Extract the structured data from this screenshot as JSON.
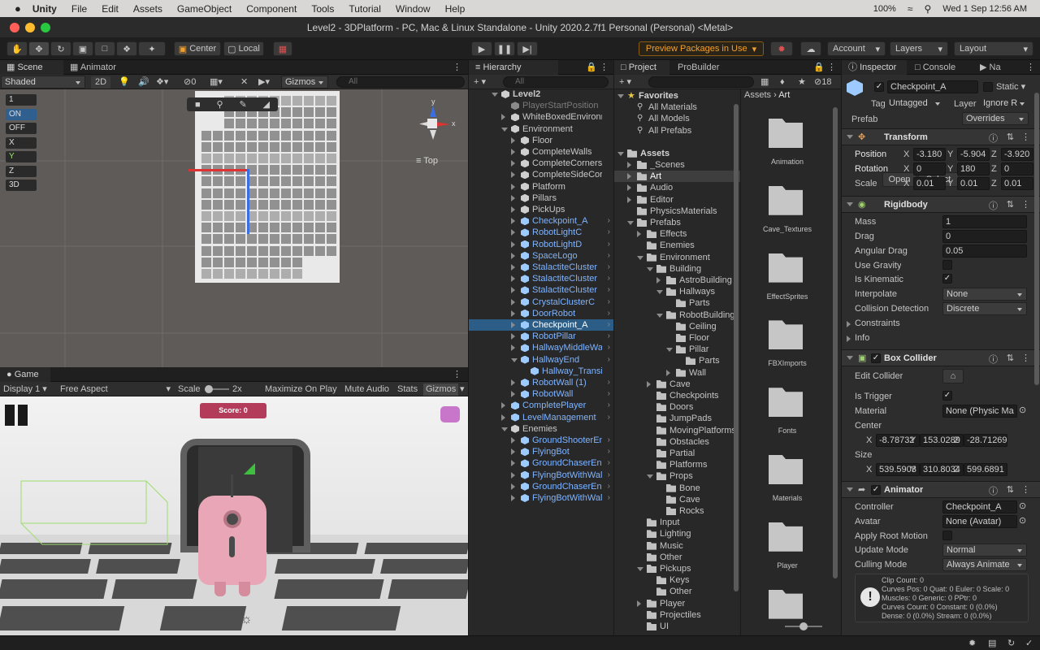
{
  "menubar": {
    "app": "Unity",
    "items": [
      "File",
      "Edit",
      "Assets",
      "GameObject",
      "Component",
      "Tools",
      "Tutorial",
      "Window",
      "Help"
    ],
    "battery": "100%",
    "datetime": "Wed 1 Sep  12:56 AM"
  },
  "window": {
    "title": "Level2 - 3DPlatform - PC, Mac & Linux Standalone - Unity 2020.2.7f1 Personal (Personal) <Metal>"
  },
  "toolbar": {
    "center": "Center",
    "local": "Local",
    "preview_packages": "Preview Packages in Use",
    "account": "Account",
    "layers": "Layers",
    "layout": "Layout"
  },
  "scene": {
    "tab_scene": "Scene",
    "tab_animator": "Animator",
    "shading": "Shaded",
    "mode2d": "2D",
    "hidden_count": "0",
    "gizmos": "Gizmos",
    "search_placeholder": "All",
    "view_label": "Top",
    "axis_x": "x",
    "axis_y": "y",
    "left_tools": [
      "1",
      "ON",
      "OFF",
      "X",
      "Y",
      "Z",
      "3D"
    ]
  },
  "game": {
    "tab": "Game",
    "display": "Display 1",
    "aspect": "Free Aspect",
    "scale_label": "Scale",
    "scale_value": "2x",
    "maximize": "Maximize On Play",
    "mute": "Mute Audio",
    "stats": "Stats",
    "gizmos": "Gizmos",
    "score": "Score: 0"
  },
  "hierarchy": {
    "tab": "Hierarchy",
    "search_placeholder": "All",
    "rows": [
      {
        "label": "Level2",
        "indent": 0,
        "arrow": "down",
        "icon": "unity",
        "bold": true
      },
      {
        "label": "PlayerStartPosition",
        "indent": 1,
        "arrow": "",
        "icon": "grey",
        "dim": true
      },
      {
        "label": "WhiteBoxedEnvironment",
        "indent": 1,
        "arrow": "right",
        "icon": "white"
      },
      {
        "label": "Environment",
        "indent": 1,
        "arrow": "down",
        "icon": "white"
      },
      {
        "label": "Floor",
        "indent": 2,
        "arrow": "right",
        "icon": "white"
      },
      {
        "label": "CompleteWalls",
        "indent": 2,
        "arrow": "right",
        "icon": "white"
      },
      {
        "label": "CompleteCorners",
        "indent": 2,
        "arrow": "right",
        "icon": "white"
      },
      {
        "label": "CompleteSideCorners",
        "indent": 2,
        "arrow": "right",
        "icon": "white"
      },
      {
        "label": "Platform",
        "indent": 2,
        "arrow": "right",
        "icon": "white"
      },
      {
        "label": "Pillars",
        "indent": 2,
        "arrow": "right",
        "icon": "white"
      },
      {
        "label": "PickUps",
        "indent": 2,
        "arrow": "right",
        "icon": "white"
      },
      {
        "label": "Checkpoint_A",
        "indent": 2,
        "arrow": "right",
        "icon": "blue",
        "blue": true,
        "more": true
      },
      {
        "label": "RobotLightC",
        "indent": 2,
        "arrow": "right",
        "icon": "blue",
        "blue": true,
        "more": true
      },
      {
        "label": "RobotLightD",
        "indent": 2,
        "arrow": "right",
        "icon": "blue",
        "blue": true,
        "more": true
      },
      {
        "label": "SpaceLogo",
        "indent": 2,
        "arrow": "right",
        "icon": "blue",
        "blue": true,
        "more": true
      },
      {
        "label": "StalactiteCluster",
        "indent": 2,
        "arrow": "right",
        "icon": "blue",
        "blue": true,
        "more": true
      },
      {
        "label": "StalactiteCluster",
        "indent": 2,
        "arrow": "right",
        "icon": "blue",
        "blue": true,
        "more": true
      },
      {
        "label": "StalactiteCluster",
        "indent": 2,
        "arrow": "right",
        "icon": "blue",
        "blue": true,
        "more": true
      },
      {
        "label": "CrystalClusterC",
        "indent": 2,
        "arrow": "right",
        "icon": "blue",
        "blue": true,
        "more": true
      },
      {
        "label": "DoorRobot",
        "indent": 2,
        "arrow": "right",
        "icon": "blue",
        "blue": true,
        "more": true
      },
      {
        "label": "Checkpoint_A",
        "indent": 2,
        "arrow": "right",
        "icon": "blue",
        "sel": true,
        "more": true
      },
      {
        "label": "RobotPillar",
        "indent": 2,
        "arrow": "right",
        "icon": "blue",
        "blue": true,
        "more": true
      },
      {
        "label": "HallwayMiddleWall",
        "indent": 2,
        "arrow": "right",
        "icon": "blue",
        "blue": true,
        "more": true
      },
      {
        "label": "HallwayEnd",
        "indent": 2,
        "arrow": "down",
        "icon": "blue",
        "blue": true,
        "more": true
      },
      {
        "label": "Hallway_Transition",
        "indent": 3,
        "arrow": "",
        "icon": "blue",
        "blue": true
      },
      {
        "label": "RobotWall (1)",
        "indent": 2,
        "arrow": "right",
        "icon": "blue",
        "blue": true,
        "more": true
      },
      {
        "label": "RobotWall",
        "indent": 2,
        "arrow": "right",
        "icon": "blue",
        "blue": true,
        "more": true
      },
      {
        "label": "CompletePlayer",
        "indent": 1,
        "arrow": "right",
        "icon": "blue",
        "blue": true,
        "more": true
      },
      {
        "label": "LevelManagement",
        "indent": 1,
        "arrow": "right",
        "icon": "blue",
        "blue": true,
        "more": true
      },
      {
        "label": "Enemies",
        "indent": 1,
        "arrow": "down",
        "icon": "white"
      },
      {
        "label": "GroundShooterEnemy",
        "indent": 2,
        "arrow": "right",
        "icon": "blue",
        "blue": true,
        "more": true
      },
      {
        "label": "FlyingBot",
        "indent": 2,
        "arrow": "right",
        "icon": "blue",
        "blue": true,
        "more": true
      },
      {
        "label": "GroundChaserEnemy",
        "indent": 2,
        "arrow": "right",
        "icon": "blue",
        "blue": true,
        "more": true
      },
      {
        "label": "FlyingBotWithWall",
        "indent": 2,
        "arrow": "right",
        "icon": "blue",
        "blue": true,
        "more": true
      },
      {
        "label": "GroundChaserEnemy",
        "indent": 2,
        "arrow": "right",
        "icon": "blue",
        "blue": true,
        "more": true
      },
      {
        "label": "FlyingBotWithWall",
        "indent": 2,
        "arrow": "right",
        "icon": "blue",
        "blue": true,
        "more": true
      }
    ]
  },
  "project": {
    "tab_project": "Project",
    "tab_probuilder": "ProBuilder",
    "hidden_count": "18",
    "favorites_label": "Favorites",
    "favorites": [
      "All Materials",
      "All Models",
      "All Prefabs"
    ],
    "assets_label": "Assets",
    "tree": [
      {
        "label": "_Scenes",
        "indent": 1,
        "arrow": "right"
      },
      {
        "label": "Art",
        "indent": 1,
        "arrow": "right",
        "sel": true
      },
      {
        "label": "Audio",
        "indent": 1,
        "arrow": "right"
      },
      {
        "label": "Editor",
        "indent": 1,
        "arrow": "right"
      },
      {
        "label": "PhysicsMaterials",
        "indent": 1,
        "arrow": ""
      },
      {
        "label": "Prefabs",
        "indent": 1,
        "arrow": "down"
      },
      {
        "label": "Effects",
        "indent": 2,
        "arrow": "right"
      },
      {
        "label": "Enemies",
        "indent": 2,
        "arrow": ""
      },
      {
        "label": "Environment",
        "indent": 2,
        "arrow": "down"
      },
      {
        "label": "Building",
        "indent": 3,
        "arrow": "down"
      },
      {
        "label": "AstroBuilding",
        "indent": 4,
        "arrow": "right"
      },
      {
        "label": "Hallways",
        "indent": 4,
        "arrow": "down"
      },
      {
        "label": "Parts",
        "indent": 5,
        "arrow": ""
      },
      {
        "label": "RobotBuilding",
        "indent": 4,
        "arrow": "down"
      },
      {
        "label": "Ceiling",
        "indent": 5,
        "arrow": ""
      },
      {
        "label": "Floor",
        "indent": 5,
        "arrow": ""
      },
      {
        "label": "Pillar",
        "indent": 5,
        "arrow": "down"
      },
      {
        "label": "Parts",
        "indent": 6,
        "arrow": ""
      },
      {
        "label": "Wall",
        "indent": 5,
        "arrow": "right"
      },
      {
        "label": "Cave",
        "indent": 3,
        "arrow": "right"
      },
      {
        "label": "Checkpoints",
        "indent": 3,
        "arrow": ""
      },
      {
        "label": "Doors",
        "indent": 3,
        "arrow": ""
      },
      {
        "label": "JumpPads",
        "indent": 3,
        "arrow": ""
      },
      {
        "label": "MovingPlatforms",
        "indent": 3,
        "arrow": ""
      },
      {
        "label": "Obstacles",
        "indent": 3,
        "arrow": ""
      },
      {
        "label": "Partial",
        "indent": 3,
        "arrow": ""
      },
      {
        "label": "Platforms",
        "indent": 3,
        "arrow": ""
      },
      {
        "label": "Props",
        "indent": 3,
        "arrow": "down"
      },
      {
        "label": "Bone",
        "indent": 4,
        "arrow": ""
      },
      {
        "label": "Cave",
        "indent": 4,
        "arrow": ""
      },
      {
        "label": "Rocks",
        "indent": 4,
        "arrow": ""
      },
      {
        "label": "Input",
        "indent": 2,
        "arrow": ""
      },
      {
        "label": "Lighting",
        "indent": 2,
        "arrow": ""
      },
      {
        "label": "Music",
        "indent": 2,
        "arrow": ""
      },
      {
        "label": "Other",
        "indent": 2,
        "arrow": ""
      },
      {
        "label": "Pickups",
        "indent": 2,
        "arrow": "down"
      },
      {
        "label": "Keys",
        "indent": 3,
        "arrow": ""
      },
      {
        "label": "Other",
        "indent": 3,
        "arrow": ""
      },
      {
        "label": "Player",
        "indent": 2,
        "arrow": "right"
      },
      {
        "label": "Projectiles",
        "indent": 2,
        "arrow": ""
      },
      {
        "label": "UI",
        "indent": 2,
        "arrow": ""
      }
    ],
    "breadcrumb": [
      "Assets",
      "Art"
    ],
    "grid_items": [
      "Animation",
      "Cave_Textures",
      "EffectSprites",
      "FBXImports",
      "Fonts",
      "Materials",
      "Player",
      ""
    ]
  },
  "inspector": {
    "tab_inspector": "Inspector",
    "tab_console": "Console",
    "tab_navigation": "Na",
    "object_name": "Checkpoint_A",
    "static_label": "Static",
    "tag_label": "Tag",
    "tag_value": "Untagged",
    "layer_label": "Layer",
    "layer_value": "Ignore R",
    "prefab_label": "Prefab",
    "prefab_open": "Open",
    "prefab_select": "Select",
    "prefab_overrides": "Overrides",
    "transform": {
      "title": "Transform",
      "position_label": "Position",
      "pos_x": "-3.180",
      "pos_y": "-5.904",
      "pos_z": "-3.920",
      "rotation_label": "Rotation",
      "rot_x": "0",
      "rot_y": "180",
      "rot_z": "0",
      "scale_label": "Scale",
      "scl_x": "0.01",
      "scl_y": "0.01",
      "scl_z": "0.01"
    },
    "rigidbody": {
      "title": "Rigidbody",
      "mass_label": "Mass",
      "mass": "1",
      "drag_label": "Drag",
      "drag": "0",
      "angular_label": "Angular Drag",
      "angular": "0.05",
      "gravity_label": "Use Gravity",
      "kinematic_label": "Is Kinematic",
      "interpolate_label": "Interpolate",
      "interpolate": "None",
      "collision_label": "Collision Detection",
      "collision": "Discrete",
      "constraints_label": "Constraints",
      "info_label": "Info"
    },
    "boxcollider": {
      "title": "Box Collider",
      "edit_label": "Edit Collider",
      "trigger_label": "Is Trigger",
      "material_label": "Material",
      "material": "None (Physic Ma",
      "center_label": "Center",
      "c_x": "-8.78732",
      "c_y": "153.0289",
      "c_z": "-28.71269",
      "size_label": "Size",
      "s_x": "539.5903",
      "s_y": "310.8034",
      "s_z": "599.6891"
    },
    "animator": {
      "title": "Animator",
      "controller_label": "Controller",
      "controller": "Checkpoint_A",
      "avatar_label": "Avatar",
      "avatar": "None (Avatar)",
      "root_label": "Apply Root Motion",
      "update_label": "Update Mode",
      "update": "Normal",
      "culling_label": "Culling Mode",
      "culling": "Always Animate",
      "info_lines": [
        "Clip Count: 0",
        "Curves Pos: 0 Quat: 0 Euler: 0 Scale: 0",
        "Muscles: 0 Generic: 0 PPtr: 0",
        "Curves Count: 0 Constant: 0 (0.0%)",
        "Dense: 0 (0.0%) Stream: 0 (0.0%)"
      ]
    }
  },
  "colors": {
    "selection": "#2c5d87",
    "prefab_blue": "#7fb4ff",
    "accent_orange": "#f0a030"
  }
}
